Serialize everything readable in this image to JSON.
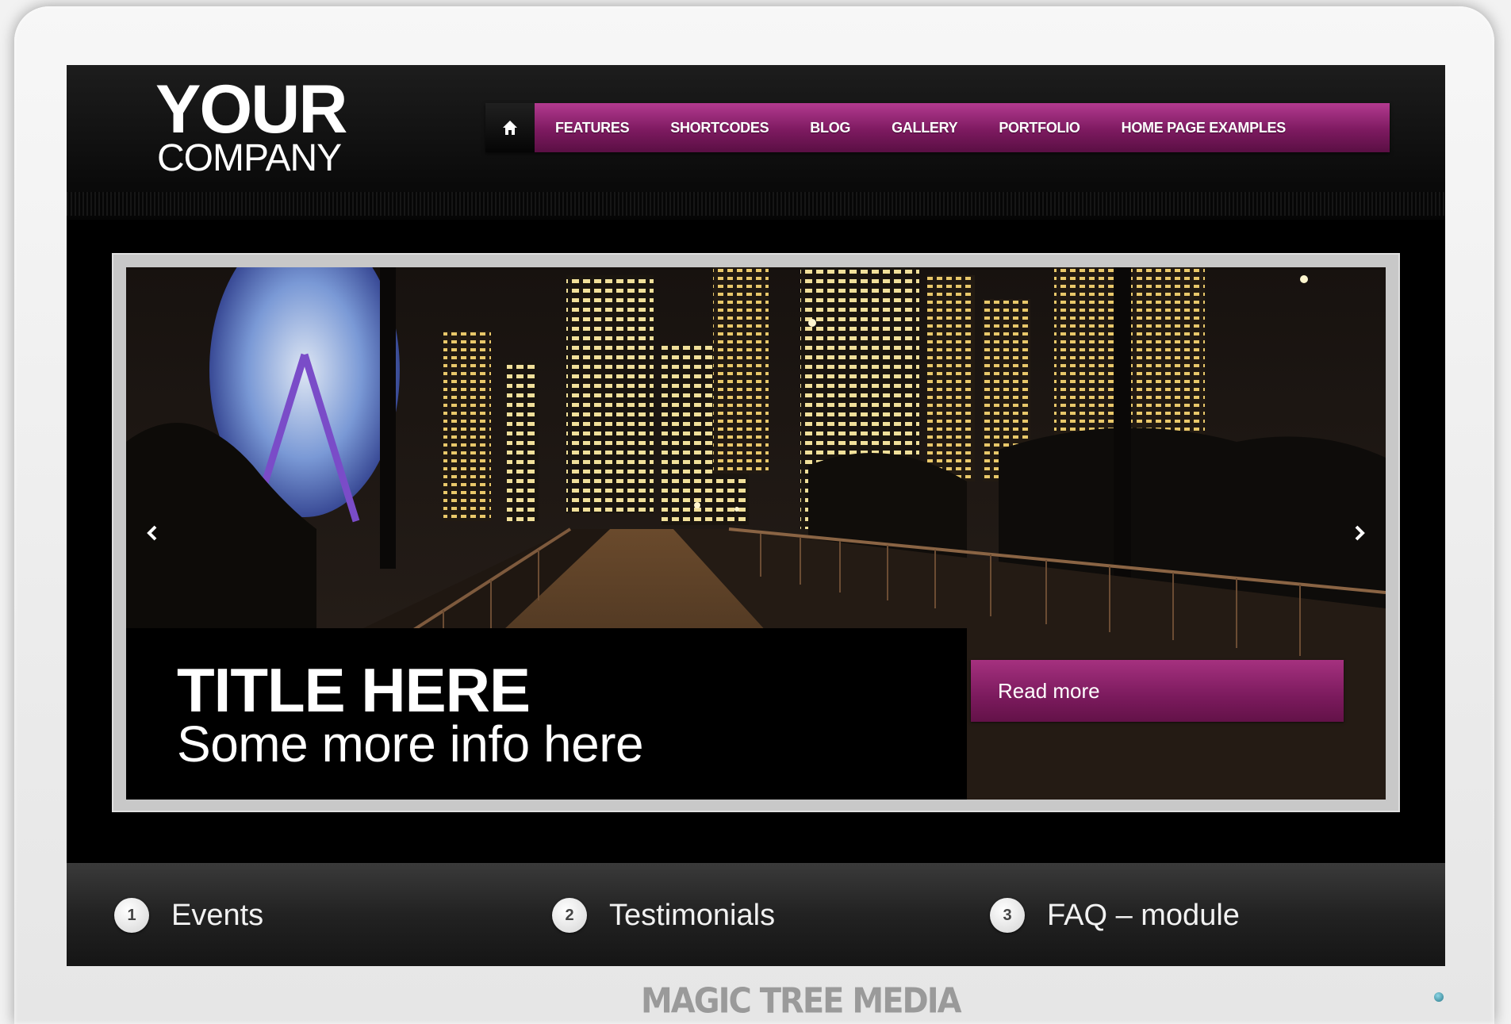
{
  "logo": {
    "top": "YOUR",
    "bottom": "COMPANY"
  },
  "nav": {
    "home_icon": "home-icon",
    "items": [
      {
        "label": "FEATURES"
      },
      {
        "label": "SHORTCODES"
      },
      {
        "label": "BLOG"
      },
      {
        "label": "GALLERY"
      },
      {
        "label": "PORTFOLIO"
      },
      {
        "label": "HOME PAGE EXAMPLES"
      }
    ]
  },
  "slider": {
    "title": "TITLE HERE",
    "subtitle": "Some more info here",
    "button_label": "Read more",
    "prev_icon": "chevron-left-icon",
    "next_icon": "chevron-right-icon"
  },
  "tabs": [
    {
      "number": "1",
      "label": "Events"
    },
    {
      "number": "2",
      "label": "Testimonials"
    },
    {
      "number": "3",
      "label": "FAQ – module"
    }
  ],
  "watermark": "MAGIC TREE MEDIA",
  "colors": {
    "accent": "#8a1f6c",
    "background": "#000000",
    "frame": "#ececec"
  }
}
